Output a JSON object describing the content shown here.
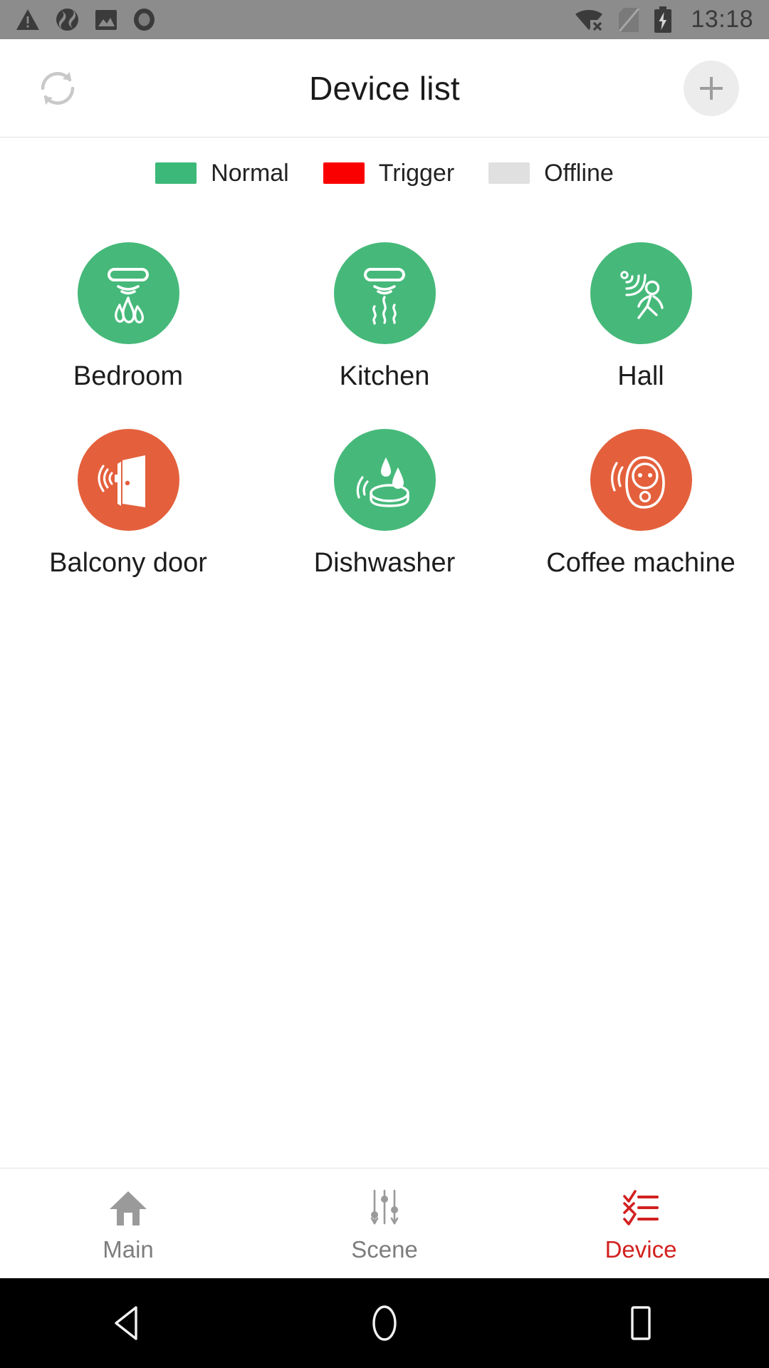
{
  "status_bar": {
    "time": "13:18",
    "background": "#8c8c8c",
    "left_icons": [
      "warning-triangle-icon",
      "sync-icon",
      "image-icon",
      "record-circle-icon"
    ],
    "right_icons": [
      "wifi-off-icon",
      "no-sim-icon",
      "battery-charging-icon"
    ]
  },
  "header": {
    "title": "Device list",
    "refresh_icon": "refresh-icon",
    "add_icon": "plus-icon"
  },
  "legend": {
    "items": [
      {
        "label": "Normal",
        "color": "#3cb878"
      },
      {
        "label": "Trigger",
        "color": "#fb0000"
      },
      {
        "label": "Offline",
        "color": "#e0e0e0"
      }
    ]
  },
  "devices": [
    {
      "label": "Bedroom",
      "status": "Normal",
      "color": "#46b97a",
      "icon": "smoke-fire-detector-icon"
    },
    {
      "label": "Kitchen",
      "status": "Normal",
      "color": "#46b97a",
      "icon": "gas-smoke-detector-icon"
    },
    {
      "label": "Hall",
      "status": "Normal",
      "color": "#46b97a",
      "icon": "motion-sensor-icon"
    },
    {
      "label": "Balcony door",
      "status": "Trigger",
      "color": "#e4603c",
      "icon": "door-sensor-icon"
    },
    {
      "label": "Dishwasher",
      "status": "Normal",
      "color": "#46b97a",
      "icon": "water-leak-sensor-icon"
    },
    {
      "label": "Coffee machine",
      "status": "Trigger",
      "color": "#e4603c",
      "icon": "smart-plug-icon"
    }
  ],
  "tabs": [
    {
      "label": "Main",
      "icon": "home-icon",
      "active": false
    },
    {
      "label": "Scene",
      "icon": "sliders-icon",
      "active": false
    },
    {
      "label": "Device",
      "icon": "checklist-icon",
      "active": true
    }
  ],
  "system_nav": {
    "back": "back-triangle-icon",
    "home": "home-circle-icon",
    "recents": "recents-square-icon"
  },
  "colors": {
    "normal": "#46b97a",
    "trigger": "#e4603c",
    "offline": "#e0e0e0",
    "accent": "#d32020"
  }
}
